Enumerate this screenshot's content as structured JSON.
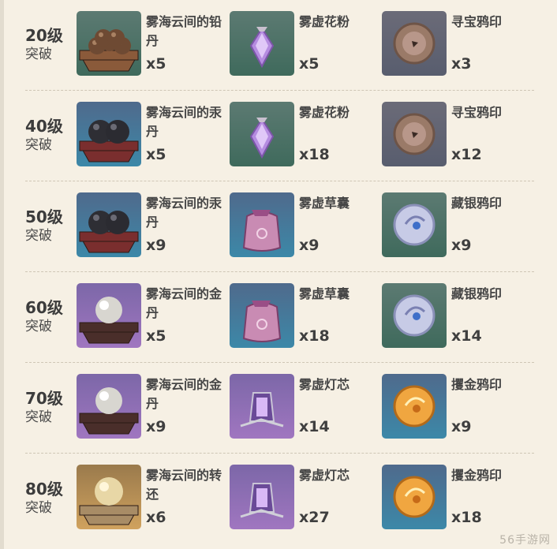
{
  "rows": [
    {
      "level": "20级",
      "label": "突破",
      "items": [
        {
          "name": "雾海云间的铅丹",
          "count": "x5",
          "icon": "lead-pills-icon"
        },
        {
          "name": "雾虚花粉",
          "count": "x5",
          "icon": "mist-pollen-icon"
        },
        {
          "name": "寻宝鸦印",
          "count": "x3",
          "icon": "treasure-crow-seal-icon"
        }
      ]
    },
    {
      "level": "40级",
      "label": "突破",
      "items": [
        {
          "name": "雾海云间的汞丹",
          "count": "x5",
          "icon": "mercury-pills-icon"
        },
        {
          "name": "雾虚花粉",
          "count": "x18",
          "icon": "mist-pollen-icon"
        },
        {
          "name": "寻宝鸦印",
          "count": "x12",
          "icon": "treasure-crow-seal-icon"
        }
      ]
    },
    {
      "level": "50级",
      "label": "突破",
      "items": [
        {
          "name": "雾海云间的汞丹",
          "count": "x9",
          "icon": "mercury-pills-icon"
        },
        {
          "name": "雾虚草囊",
          "count": "x9",
          "icon": "mist-grass-pouch-icon"
        },
        {
          "name": "藏银鸦印",
          "count": "x9",
          "icon": "silver-crow-seal-icon"
        }
      ]
    },
    {
      "level": "60级",
      "label": "突破",
      "items": [
        {
          "name": "雾海云间的金丹",
          "count": "x5",
          "icon": "gold-pill-icon"
        },
        {
          "name": "雾虚草囊",
          "count": "x18",
          "icon": "mist-grass-pouch-icon"
        },
        {
          "name": "藏银鸦印",
          "count": "x14",
          "icon": "silver-crow-seal-icon"
        }
      ]
    },
    {
      "level": "70级",
      "label": "突破",
      "items": [
        {
          "name": "雾海云间的金丹",
          "count": "x9",
          "icon": "gold-pill-icon"
        },
        {
          "name": "雾虚灯芯",
          "count": "x14",
          "icon": "mist-lantern-wick-icon"
        },
        {
          "name": "攫金鸦印",
          "count": "x9",
          "icon": "golden-crow-seal-icon"
        }
      ]
    },
    {
      "level": "80级",
      "label": "突破",
      "items": [
        {
          "name": "雾海云间的转还",
          "count": "x6",
          "icon": "transmutation-pill-icon"
        },
        {
          "name": "雾虚灯芯",
          "count": "x27",
          "icon": "mist-lantern-wick-icon"
        },
        {
          "name": "攫金鸦印",
          "count": "x18",
          "icon": "golden-crow-seal-icon"
        }
      ]
    }
  ],
  "watermark": "56手游网"
}
